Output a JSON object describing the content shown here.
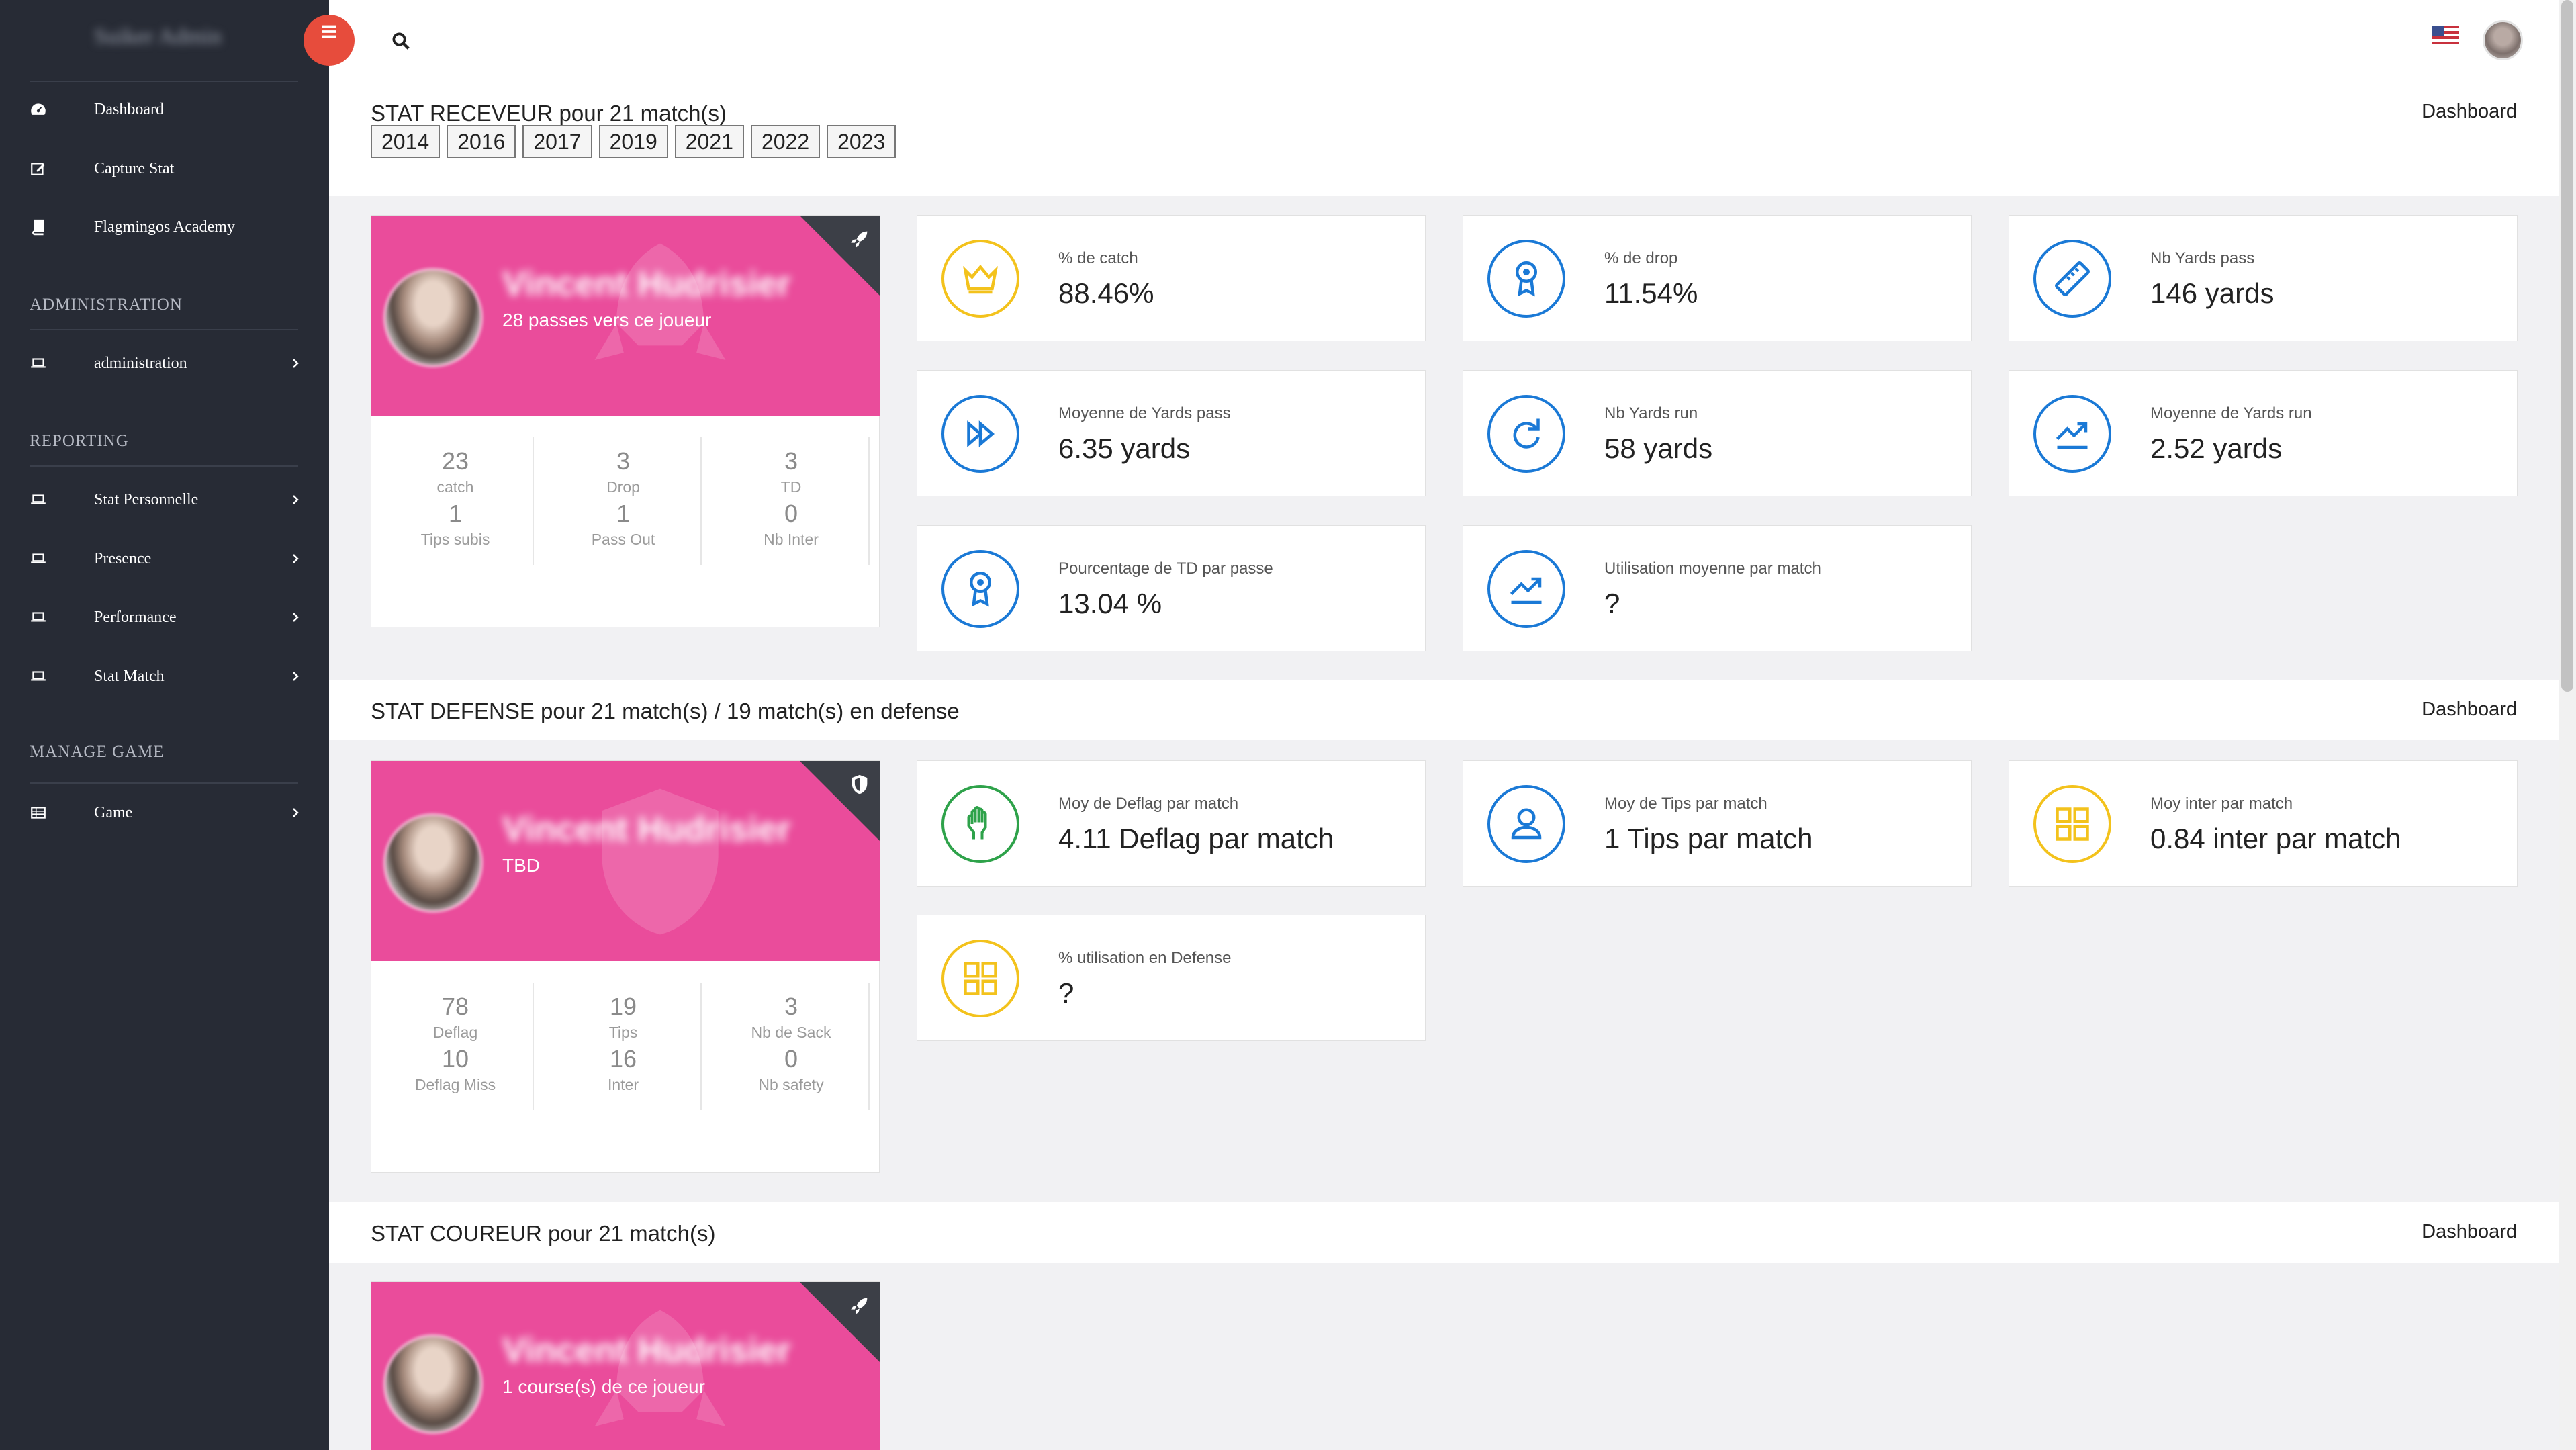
{
  "brand": {
    "name": "Suiker Admin"
  },
  "sidebar": {
    "items": [
      {
        "label": "Dashboard",
        "icon": "dashboard-icon"
      },
      {
        "label": "Capture Stat",
        "icon": "edit-icon"
      },
      {
        "label": "Flagmingos Academy",
        "icon": "book-icon"
      }
    ],
    "sections": [
      {
        "title": "ADMINISTRATION",
        "items": [
          {
            "label": "administration",
            "icon": "laptop-icon"
          }
        ]
      },
      {
        "title": "REPORTING",
        "items": [
          {
            "label": "Stat Personnelle",
            "icon": "laptop-icon"
          },
          {
            "label": "Presence",
            "icon": "laptop-icon"
          },
          {
            "label": "Performance",
            "icon": "laptop-icon"
          },
          {
            "label": "Stat Match",
            "icon": "laptop-icon"
          }
        ]
      },
      {
        "title": "MANAGE GAME",
        "items": [
          {
            "label": "Game",
            "icon": "table-icon"
          }
        ]
      }
    ]
  },
  "header": {
    "search_icon": "search-icon",
    "flag_icon": "us-flag-icon"
  },
  "receveur": {
    "title": "STAT RECEVEUR pour 21 match(s)",
    "link": "Dashboard",
    "years": [
      "2014",
      "2016",
      "2017",
      "2019",
      "2021",
      "2022",
      "2023"
    ],
    "profile": {
      "name": "Vincent Hudrisier",
      "subtitle": "28 passes vers ce joueur",
      "stats": [
        {
          "value": "23",
          "label": "catch"
        },
        {
          "value": "3",
          "label": "Drop"
        },
        {
          "value": "3",
          "label": "TD"
        },
        {
          "value": "1",
          "label": "Tips subis"
        },
        {
          "value": "1",
          "label": "Pass Out"
        },
        {
          "value": "0",
          "label": "Nb Inter"
        }
      ]
    },
    "boxes": [
      {
        "label": "% de catch",
        "value": "88.46%",
        "icon": "crown-icon",
        "color": "#f3c21c"
      },
      {
        "label": "% de drop",
        "value": "11.54%",
        "icon": "award-icon",
        "color": "#1a79d6"
      },
      {
        "label": "Nb Yards pass",
        "value": "146 yards",
        "icon": "ruler-icon",
        "color": "#1a79d6"
      },
      {
        "label": "Moyenne de Yards pass",
        "value": "6.35 yards",
        "icon": "fast-forward-icon",
        "color": "#1a79d6"
      },
      {
        "label": "Nb Yards run",
        "value": "58 yards",
        "icon": "redo-icon",
        "color": "#1a79d6"
      },
      {
        "label": "Moyenne de Yards run",
        "value": "2.52 yards",
        "icon": "trending-icon",
        "color": "#1a79d6"
      },
      {
        "label": "Pourcentage de TD par passe",
        "value": "13.04 %",
        "icon": "award-icon",
        "color": "#1a79d6"
      },
      {
        "label": "Utilisation moyenne par match",
        "value": "?",
        "icon": "trending-icon",
        "color": "#1a79d6"
      }
    ]
  },
  "defense": {
    "title": "STAT DEFENSE pour 21 match(s) / 19 match(s) en defense",
    "link": "Dashboard",
    "profile": {
      "name": "Vincent Hudrisier",
      "subtitle": "TBD",
      "stats": [
        {
          "value": "78",
          "label": "Deflag"
        },
        {
          "value": "19",
          "label": "Tips"
        },
        {
          "value": "3",
          "label": "Nb de Sack"
        },
        {
          "value": "10",
          "label": "Deflag Miss"
        },
        {
          "value": "16",
          "label": "Inter"
        },
        {
          "value": "0",
          "label": "Nb safety"
        }
      ]
    },
    "boxes": [
      {
        "label": "Moy de Deflag par match",
        "value": "4.11 Deflag par match",
        "icon": "hand-icon",
        "color": "#2ea24a"
      },
      {
        "label": "Moy de Tips par match",
        "value": "1 Tips par match",
        "icon": "user-icon",
        "color": "#1a79d6"
      },
      {
        "label": "Moy inter par match",
        "value": "0.84 inter par match",
        "icon": "grid-icon",
        "color": "#f3c21c"
      },
      {
        "label": "% utilisation en Defense",
        "value": "?",
        "icon": "grid-icon",
        "color": "#f3c21c"
      }
    ]
  },
  "coureur": {
    "title": "STAT COUREUR pour 21 match(s)",
    "link": "Dashboard",
    "profile": {
      "name": "Vincent Hudrisier",
      "subtitle": "1 course(s) de ce joueur"
    }
  }
}
